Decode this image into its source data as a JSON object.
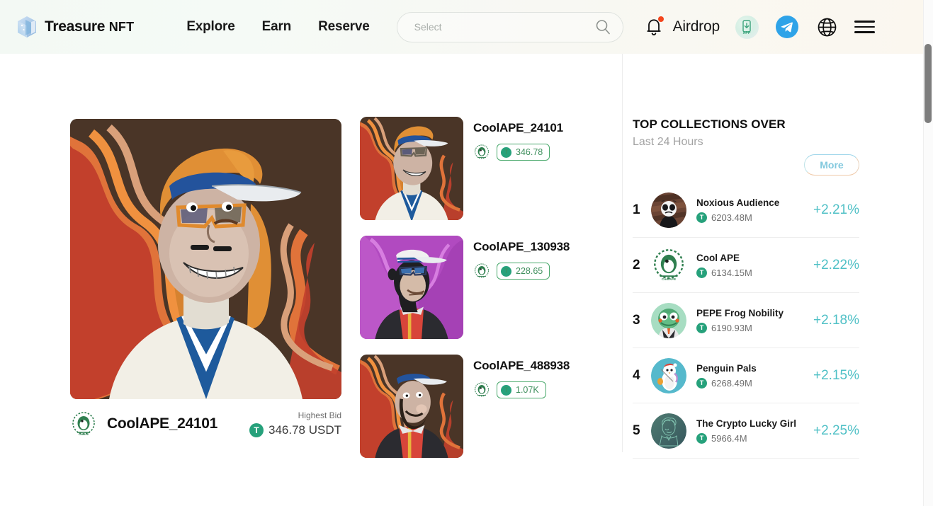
{
  "brand": {
    "name": "Treasure",
    "suffix": "NFT",
    "logo_icon": "treasure-gem-logo"
  },
  "nav": {
    "items": [
      {
        "label": "Explore"
      },
      {
        "label": "Earn"
      },
      {
        "label": "Reserve"
      }
    ]
  },
  "search": {
    "placeholder": "Select",
    "value": "",
    "icon": "search-icon"
  },
  "header_right": {
    "bell_icon": "notification-bell-icon",
    "bell_has_badge": true,
    "airdrop_label": "Airdrop",
    "app_badge_label": "APP",
    "telegram_icon": "telegram-icon",
    "globe_icon": "globe-language-icon",
    "menu_icon": "hamburger-menu-icon"
  },
  "hero": {
    "art_alt": "CoolAPE_24101 sailor ape with visor and sunglasses on flame background",
    "avatar_alt": "Cool APE collection avatar",
    "name": "CoolAPE_24101",
    "bid_label": "Highest Bid",
    "bid_value": "346.78 USDT",
    "token_icon": "tether-usdt-icon"
  },
  "thumbnails": [
    {
      "title": "CoolAPE_24101",
      "price": "346.78",
      "avatar_alt": "Cool APE collection avatar",
      "art_alt": "sailor ape with blue visor on flame background",
      "bg": "#4a3527"
    },
    {
      "title": "CoolAPE_130938",
      "price": "228.65",
      "avatar_alt": "Cool APE collection avatar",
      "art_alt": "dark ape with sailor cap and red puffer jacket on purple background",
      "bg": "#b14ac0"
    },
    {
      "title": "CoolAPE_488938",
      "price": "1.07K",
      "avatar_alt": "Cool APE collection avatar",
      "art_alt": "bearded ape with blue visor and red puffer jacket on flame background",
      "bg": "#4a3527"
    }
  ],
  "panel": {
    "title": "TOP COLLECTIONS OVER",
    "subtitle": "Last 24 Hours",
    "more_label": "More",
    "accent_color": "#4fc0c6",
    "rows": [
      {
        "rank": "1",
        "name": "Noxious Audience",
        "amount": "6203.48M",
        "change": "+2.21%",
        "avatar_alt": "panda face on brown striped background"
      },
      {
        "rank": "2",
        "name": "Cool APE",
        "amount": "6134.15M",
        "change": "+2.22%",
        "avatar_alt": "green ape emblem in circle"
      },
      {
        "rank": "3",
        "name": "PEPE Frog Nobility",
        "amount": "6190.93M",
        "change": "+2.18%",
        "avatar_alt": "pepe frog in suit"
      },
      {
        "rank": "4",
        "name": "Penguin Pals",
        "amount": "6268.49M",
        "change": "+2.15%",
        "avatar_alt": "penguin fishing with red hat"
      },
      {
        "rank": "5",
        "name": "The Crypto Lucky Girl",
        "amount": "5966.4M",
        "change": "+2.25%",
        "avatar_alt": "line art girl on teal background"
      }
    ]
  },
  "scrollbar": {
    "position": "right"
  }
}
